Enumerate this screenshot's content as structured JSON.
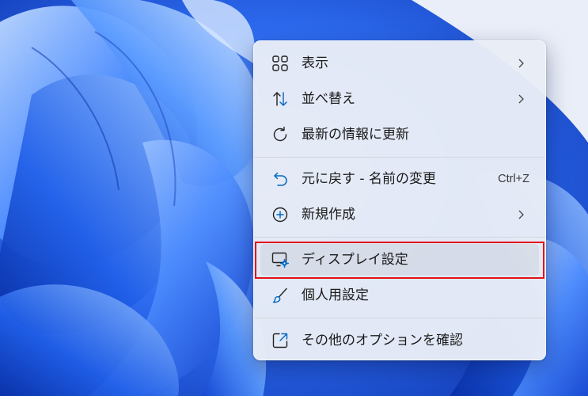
{
  "context_menu": {
    "items": [
      {
        "label": "表示",
        "icon": "grid-view-icon",
        "has_submenu": true
      },
      {
        "label": "並べ替え",
        "icon": "sort-arrows-icon",
        "has_submenu": true
      },
      {
        "label": "最新の情報に更新",
        "icon": "refresh-icon",
        "has_submenu": false
      },
      {
        "label": "元に戻す - 名前の変更",
        "icon": "undo-icon",
        "shortcut": "Ctrl+Z",
        "has_submenu": false
      },
      {
        "label": "新規作成",
        "icon": "new-plus-icon",
        "has_submenu": true
      },
      {
        "label": "ディスプレイ設定",
        "icon": "display-settings-icon",
        "has_submenu": false,
        "highlighted": true
      },
      {
        "label": "個人用設定",
        "icon": "brush-icon",
        "has_submenu": false
      },
      {
        "label": "その他のオプションを確認",
        "icon": "show-more-options-icon",
        "has_submenu": false
      }
    ]
  },
  "colors": {
    "accent": "#0067c0",
    "highlight_border": "#e3121a",
    "wallpaper": "#1b4fd6"
  }
}
